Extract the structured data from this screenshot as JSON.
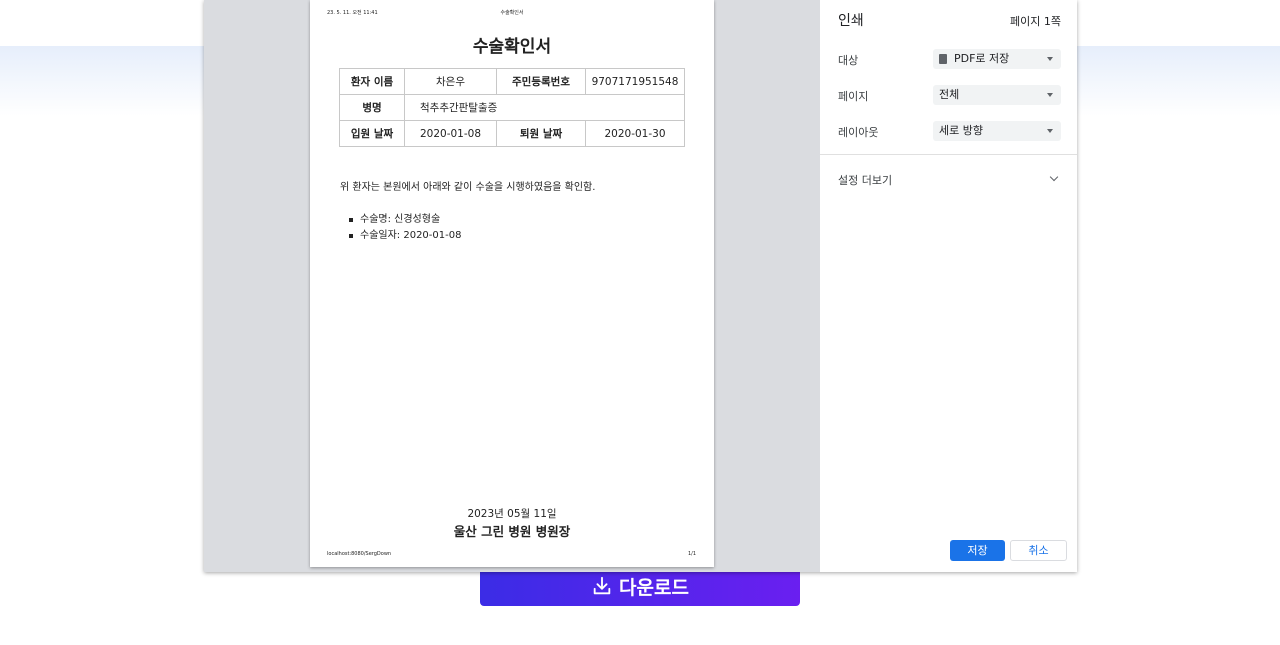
{
  "download_button": {
    "label": "다운로드"
  },
  "document": {
    "header_left": "23. 5. 11. 오전 11:41",
    "header_center": "수술확인서",
    "title": "수술확인서",
    "table": {
      "patient_name_label": "환자 이름",
      "patient_name": "차은우",
      "resident_id_label": "주민등록번호",
      "resident_id": "9707171951548",
      "disease_label": "병명",
      "disease": "척추추간판탈출증",
      "admit_label": "입원 날짜",
      "admit_date": "2020-01-08",
      "discharge_label": "퇴원 날짜",
      "discharge_date": "2020-01-30"
    },
    "statement": "위 환자는 본원에서 아래와 같이 수술을 시행하였음을 확인함.",
    "items": [
      "수술명: 신경성형술",
      "수술일자: 2020-01-08"
    ],
    "issue_date": "2023년 05월 11일",
    "signature": "울산 그린 병원 병원장",
    "footer_left": "localhost:8080/SergDown",
    "footer_right": "1/1"
  },
  "print_settings": {
    "title": "인쇄",
    "page_count": "페이지 1쪽",
    "destination_label": "대상",
    "destination_value": "PDF로 저장",
    "pages_label": "페이지",
    "pages_value": "전체",
    "layout_label": "레이아웃",
    "layout_value": "세로 방향",
    "more_settings": "설정 더보기",
    "save_button": "저장",
    "cancel_button": "취소"
  }
}
